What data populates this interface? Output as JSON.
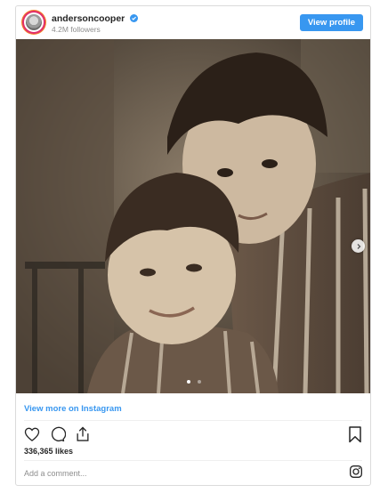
{
  "header": {
    "username": "andersoncooper",
    "followers": "4.2M followers",
    "view_profile_label": "View profile",
    "avatar_icon": "profile-avatar",
    "verified_icon": "verified-badge-icon"
  },
  "post": {
    "photo_description_icon": "photo",
    "next_icon": "chevron-right-icon",
    "carousel_total": 2,
    "carousel_active": 1
  },
  "footer": {
    "view_more_label": "View more on Instagram",
    "likes": "336,365 likes",
    "comment_placeholder": "Add a comment...",
    "actions": {
      "like_icon": "heart-icon",
      "comment_icon": "comment-icon",
      "share_icon": "share-icon",
      "save_icon": "bookmark-icon",
      "instagram_icon": "instagram-logo-icon"
    }
  },
  "colors": {
    "accent": "#3897f0",
    "text": "#262626",
    "muted": "#8e8e8e",
    "border": "#dbdbdb"
  }
}
